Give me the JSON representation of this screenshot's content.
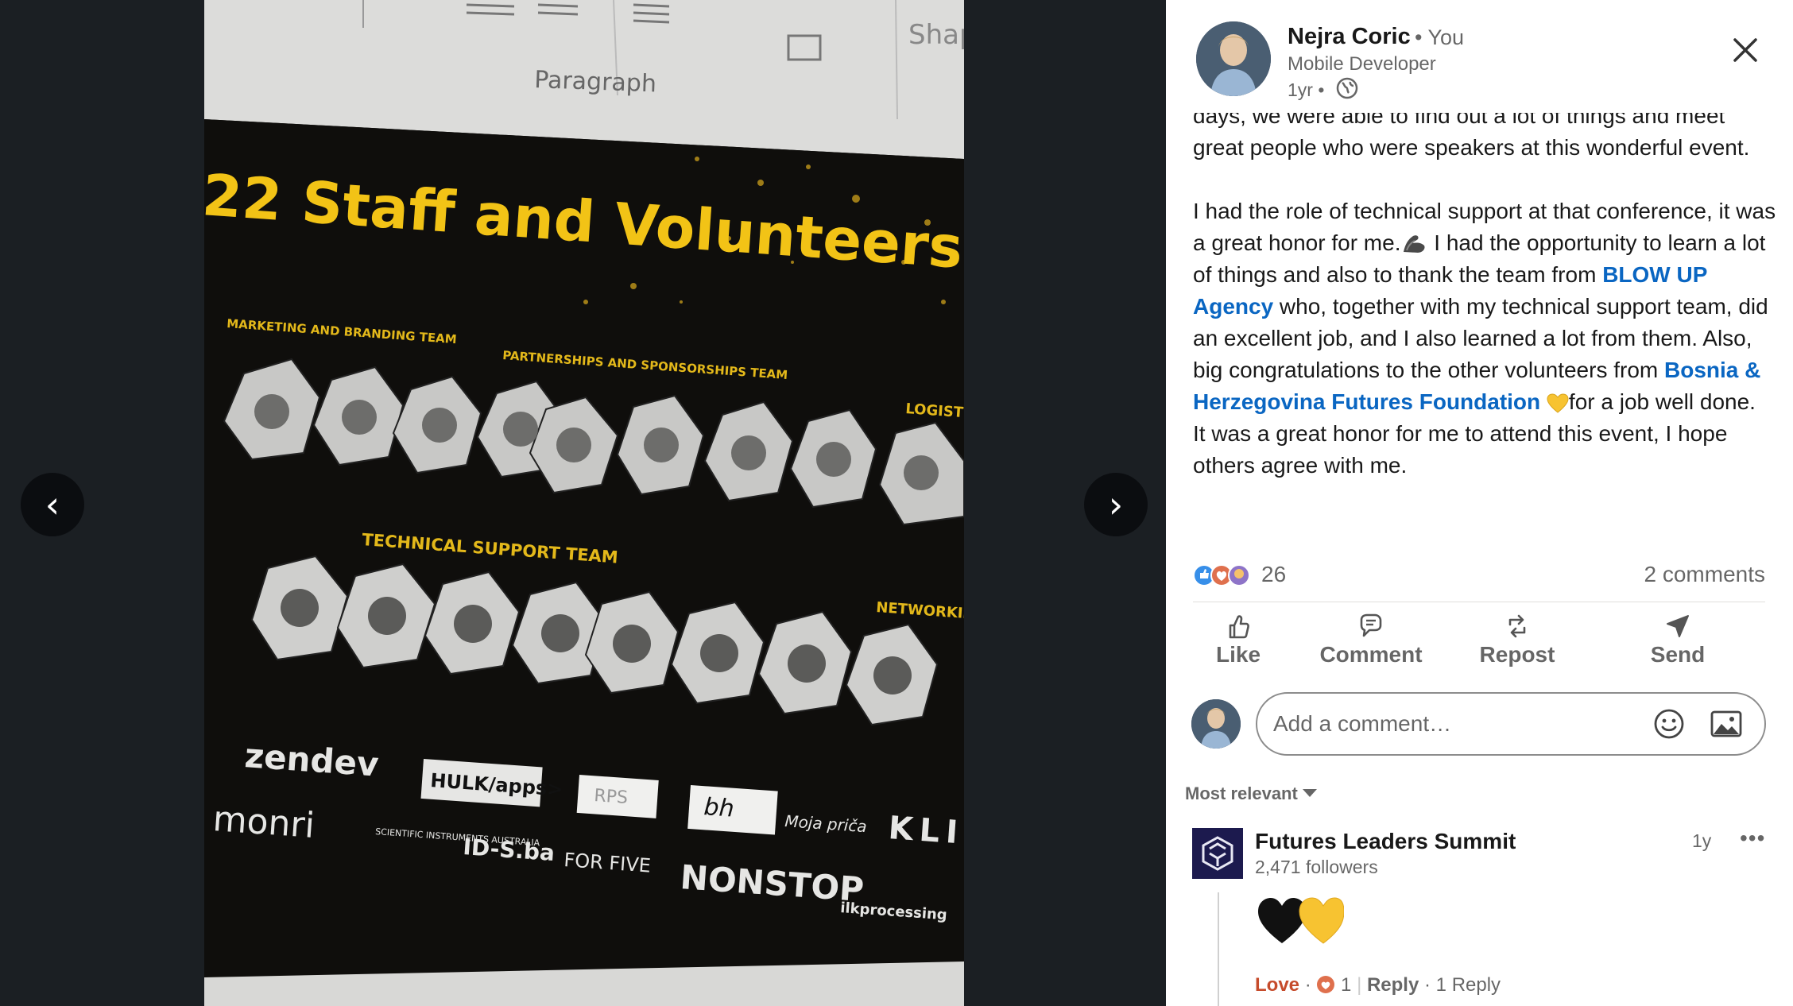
{
  "viewer": {
    "prev_glyph": "‹",
    "next_glyph": "›",
    "photo": {
      "toolbar_paragraph": "Paragraph",
      "toolbar_shape": "Shap",
      "heading": "22 Staff and Volunteers",
      "teams": {
        "marketing": "MARKETING AND BRANDING TEAM",
        "partnerships": "PARTNERSHIPS AND SPONSORSHIPS TEAM",
        "logistics": "LOGISTICS",
        "technical": "TECHNICAL SUPPORT TEAM",
        "networking": "NETWORKING TE"
      },
      "logos": {
        "zendev": "zendev",
        "hulk": "HULK/apps>",
        "rps": "RPS",
        "bh": "bh",
        "moja": "Moja priča",
        "kl": "KLI",
        "monri": "monri",
        "scientific": "SCIENTIFIC INSTRUMENTS AUSTRALIA",
        "ids": "ID-S.ba",
        "forfive": "FOR FIVE",
        "nonstop": "NONSTOP",
        "ilk": "ilkprocessing"
      }
    }
  },
  "post": {
    "author": {
      "name": "Nejra Coric",
      "relation": "• You",
      "headline": "Mobile Developer",
      "time": "1yr •"
    },
    "body": {
      "line_intro": "days, we were able to find out a lot of things and meet great people who were speakers at this wonderful event.",
      "p2_a": "I had the role of technical support at that conference, it was a great honor for me.",
      "p2_b": " I had the opportunity to learn a lot of things and also to thank the team from ",
      "mention_1": "BLOW UP Agency",
      "p2_c": " who, together with my technical support team, did an excellent job, and I also learned a lot from them. Also, big congratulations to the other volunteers from ",
      "mention_2": "Bosnia & Herzegovina Futures Foundation",
      "p2_d": "for a job well done.",
      "p3": "It was a great honor for me to attend this event, I hope others agree with me."
    },
    "reactions_count": "26",
    "comments_count": "2 comments",
    "actions": {
      "like": "Like",
      "comment": "Comment",
      "repost": "Repost",
      "send": "Send"
    },
    "comment_placeholder": "Add a comment…",
    "sort_label": "Most relevant",
    "comment": {
      "author": "Futures Leaders Summit",
      "meta": "2,471 followers",
      "time": "1y",
      "more": "•••",
      "love": "Love",
      "love_count": "1",
      "reply": "Reply",
      "replies": "1 Reply",
      "sep": "·"
    }
  },
  "colors": {
    "link": "#0a66c2",
    "love": "#c64b2b",
    "photo_gold": "#f2c316",
    "viewer_bg": "#1b1f23"
  }
}
